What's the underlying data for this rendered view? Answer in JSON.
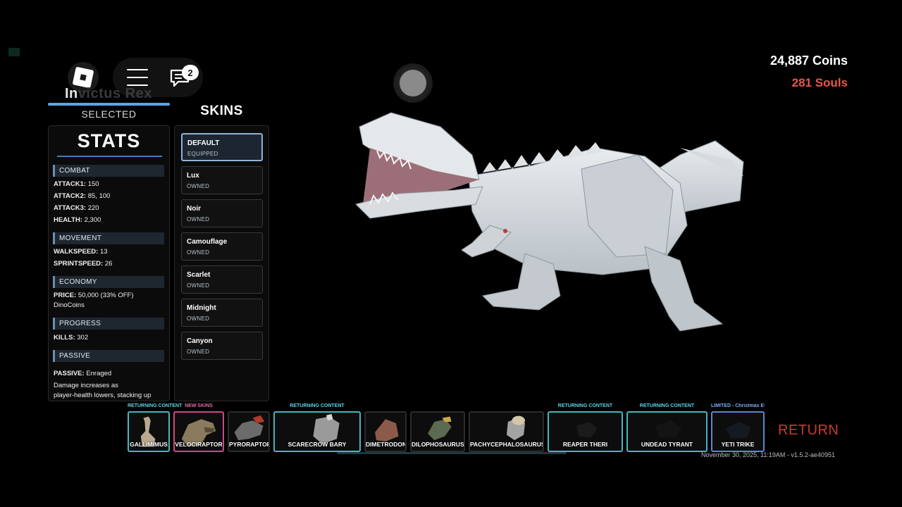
{
  "topbar": {
    "chat_badge": "2",
    "icons": [
      "roblox-logo-icon",
      "hamburger-menu-icon",
      "chat-icon"
    ]
  },
  "dino": {
    "name_visible": "In",
    "name_obscured": "victus Rex",
    "selected_label": "SELECTED"
  },
  "stats": {
    "title": "STATS",
    "combat": {
      "header": "COMBAT",
      "lines": [
        {
          "k": "ATTACK1:",
          "v": "150"
        },
        {
          "k": "ATTACK2:",
          "v": "85, 100"
        },
        {
          "k": "ATTACK3:",
          "v": "220"
        },
        {
          "k": "HEALTH:",
          "v": "2,300"
        }
      ]
    },
    "movement": {
      "header": "MOVEMENT",
      "lines": [
        {
          "k": "WALKSPEED:",
          "v": "13"
        },
        {
          "k": "SPRINTSPEED:",
          "v": "26"
        }
      ]
    },
    "economy": {
      "header": "ECONOMY",
      "price_k": "PRICE:",
      "price_v": "50,000 (33% OFF)",
      "currency": "DinoCoins"
    },
    "progress": {
      "header": "PROGRESS",
      "kills_k": "KILLS:",
      "kills_v": "302"
    },
    "passive": {
      "header": "PASSIVE",
      "passive_k": "PASSIVE:",
      "passive_v": "Enraged",
      "desc1": "Damage increases as",
      "desc2": "player-health lowers, stacking up"
    }
  },
  "skins": {
    "title": "SKINS",
    "items": [
      {
        "name": "DEFAULT",
        "status": "EQUIPPED"
      },
      {
        "name": "Lux",
        "status": "OWNED"
      },
      {
        "name": "Noir",
        "status": "OWNED"
      },
      {
        "name": "Camouflage",
        "status": "OWNED"
      },
      {
        "name": "Scarlet",
        "status": "OWNED"
      },
      {
        "name": "Midnight",
        "status": "OWNED"
      },
      {
        "name": "Canyon",
        "status": "OWNED"
      }
    ]
  },
  "currency": {
    "coins": "24,887 Coins",
    "souls": "281 Souls",
    "souls_color": "#e9564a"
  },
  "carousel": {
    "cards": [
      {
        "name": "GALLIMIMUS",
        "tag": "RETURNING CONTENT",
        "style": "teal"
      },
      {
        "name": "VELOCIRAPTOR",
        "tag": "NEW SKINS",
        "style": "pink"
      },
      {
        "name": "PYRORAPTOR",
        "tag": "",
        "style": "plain"
      },
      {
        "name": "SCARECROW BARY",
        "tag": "RETURNING CONTENT",
        "style": "teal"
      },
      {
        "name": "DIMETRODON",
        "tag": "",
        "style": "plain"
      },
      {
        "name": "DILOPHOSAURUS",
        "tag": "",
        "style": "plain"
      },
      {
        "name": "PACHYCEPHALOSAURUS",
        "tag": "",
        "style": "plain"
      },
      {
        "name": "REAPER THERI",
        "tag": "RETURNING CONTENT",
        "style": "teal"
      },
      {
        "name": "UNDEAD TYRANT",
        "tag": "RETURNING CONTENT",
        "style": "teal"
      },
      {
        "name": "YETI TRIKE",
        "tag": "LIMITED - Christmas Eve",
        "style": "blue"
      }
    ]
  },
  "footer": {
    "return_label": "RETURN",
    "meta": "November 30, 2025, 11:19AM - v1.5.2-ae40951"
  },
  "colors": {
    "accent_blue": "#5aa6e6",
    "teal": "#47b6c0",
    "pink": "#d0468a",
    "return_red": "#c93b31"
  }
}
